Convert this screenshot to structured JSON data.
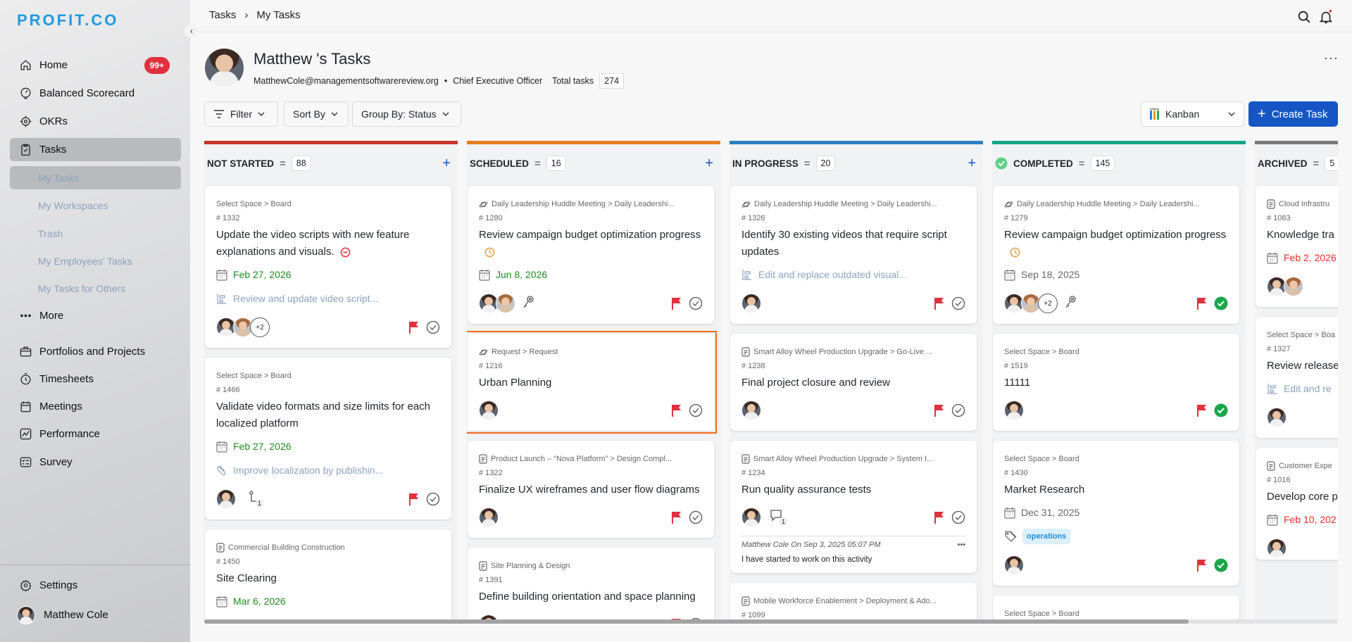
{
  "app": {
    "logo": "PROFIT.CO"
  },
  "sidebar": {
    "home_badge": "99+",
    "items": [
      {
        "label": "Home",
        "icon": "home-icon"
      },
      {
        "label": "Balanced Scorecard",
        "icon": "scorecard-icon"
      },
      {
        "label": "OKRs",
        "icon": "target-icon"
      },
      {
        "label": "Tasks",
        "icon": "clipboard-check-icon"
      },
      {
        "label": "My Tasks"
      },
      {
        "label": "My Workspaces"
      },
      {
        "label": "Trash"
      },
      {
        "label": "My Employees' Tasks"
      },
      {
        "label": "My Tasks for Others"
      },
      {
        "label": "More",
        "icon": "more-icon"
      },
      {
        "label": "Portfolios and Projects",
        "icon": "briefcase-icon"
      },
      {
        "label": "Timesheets",
        "icon": "stopwatch-icon"
      },
      {
        "label": "Meetings",
        "icon": "calendar-icon"
      },
      {
        "label": "Performance",
        "icon": "chart-icon"
      },
      {
        "label": "Survey",
        "icon": "survey-icon"
      }
    ],
    "settings": "Settings",
    "user": "Matthew Cole"
  },
  "breadcrumb": {
    "root": "Tasks",
    "sep": "›",
    "current": "My Tasks"
  },
  "header": {
    "title": "Matthew 's Tasks",
    "email": "MatthewCole@managementsoftwarereview.org",
    "role": "Chief Executive Officer",
    "total_label": "Total tasks",
    "total": "274"
  },
  "toolbar": {
    "filter": "Filter",
    "sort": "Sort By",
    "group": "Group By: Status",
    "view": "Kanban",
    "create": "Create Task"
  },
  "colors": {
    "accent": "#1556c4",
    "not_started": "#c8372d",
    "scheduled": "#e67e22",
    "in_progress": "#2b80be",
    "completed": "#17a589",
    "archived": "#7a7a7a",
    "date_green": "#1e8c1e",
    "date_red": "#ec2a2a"
  },
  "columns": [
    {
      "title": "NOT STARTED",
      "count": "88",
      "color": "#c8372d",
      "plus": true,
      "cards": [
        {
          "crumb": "Select Space > Board",
          "crumb_icon": "",
          "id": "# 1332",
          "title": "Update the video scripts with new feature explanations and visuals.",
          "title_icon": "blocked",
          "date": "Feb 27, 2026",
          "date_color": "green",
          "sub": "Review and update video script...",
          "sub_icon": "subtask",
          "avatars": 2,
          "extra": "+2",
          "status": "open"
        },
        {
          "crumb": "Select Space > Board",
          "crumb_icon": "",
          "id": "# 1466",
          "title": "Validate video formats and size limits for each localized platform",
          "date": "Feb 27, 2026",
          "date_color": "green",
          "sub": "Improve localization by publishin...",
          "sub_icon": "clip",
          "avatars": 1,
          "branch": "1",
          "status": "open"
        },
        {
          "crumb": "Commercial Building Construction",
          "crumb_icon": "doc",
          "id": "# 1450",
          "title": "Site Clearing",
          "date": "Mar 6, 2026",
          "date_color": "green",
          "avatars": 1,
          "status": "open"
        }
      ]
    },
    {
      "title": "SCHEDULED",
      "count": "16",
      "color": "#e67e22",
      "plus": true,
      "cards": [
        {
          "crumb": "Daily Leadership Huddle Meeting > Daily Leadershi...",
          "crumb_icon": "orbit",
          "id": "# 1280",
          "title": "Review campaign budget optimization progress",
          "title_icon": "clock",
          "date": "Jun 8, 2026",
          "date_color": "green",
          "avatars": 2,
          "key": true,
          "status": "open"
        },
        {
          "crumb": "Request > Request",
          "crumb_icon": "orbit",
          "id": "# 1216",
          "title": "Urban Planning",
          "avatars": 1,
          "status": "open",
          "selected": true
        },
        {
          "crumb": "Product Launch – “Nova Platform” > Design Compl...",
          "crumb_icon": "doc",
          "id": "# 1322",
          "title": "Finalize UX wireframes and user flow diagrams",
          "avatars": 1,
          "status": "open"
        },
        {
          "crumb": "Site Planning & Design",
          "crumb_icon": "doc",
          "id": "# 1391",
          "title": "Define building orientation and space planning",
          "avatars": 1,
          "status": "open"
        }
      ]
    },
    {
      "title": "IN PROGRESS",
      "count": "20",
      "color": "#2b80be",
      "plus": true,
      "cards": [
        {
          "crumb": "Daily Leadership Huddle Meeting > Daily Leadershi...",
          "crumb_icon": "orbit",
          "id": "# 1326",
          "title": "Identify 30 existing videos that require script updates",
          "sub": "Edit and replace outdated visual...",
          "sub_icon": "subtask",
          "avatars": 1,
          "status": "open"
        },
        {
          "crumb": "Smart Alloy Wheel Production Upgrade > Go-Live ...",
          "crumb_icon": "doc",
          "id": "# 1238",
          "title": "Final project closure and review",
          "avatars": 1,
          "status": "open"
        },
        {
          "crumb": "Smart Alloy Wheel Production Upgrade > System I...",
          "crumb_icon": "doc",
          "id": "# 1234",
          "title": "Run quality assurance tests",
          "avatars": 1,
          "comments": "1",
          "status": "open",
          "comment": {
            "who": "Matthew Cole On Sep 3, 2025 05:07 PM",
            "text": "I have started to work on this activity"
          }
        },
        {
          "crumb": "Mobile Workforce Enablement > Deployment & Ado...",
          "crumb_icon": "doc",
          "id": "# 1099",
          "title": "Monitor adoption metrics and provide support",
          "avatars": 1,
          "status": "open"
        }
      ]
    },
    {
      "title": "COMPLETED",
      "count": "145",
      "color": "#17a589",
      "done_icon": true,
      "cards": [
        {
          "crumb": "Daily Leadership Huddle Meeting > Daily Leadershi...",
          "crumb_icon": "orbit",
          "id": "# 1279",
          "title": "Review campaign budget optimization progress",
          "title_icon": "clock",
          "date": "Sep 18, 2025",
          "date_color": "grey",
          "avatars": 2,
          "extra": "+2",
          "key": true,
          "status": "done"
        },
        {
          "crumb": "Select Space > Board",
          "crumb_icon": "",
          "id": "# 1519",
          "title": "11111",
          "avatars": 1,
          "status": "done"
        },
        {
          "crumb": "Select Space > Board",
          "crumb_icon": "",
          "id": "# 1430",
          "title": "Market Research",
          "date": "Dec 31, 2025",
          "date_color": "grey",
          "tag": "operations",
          "avatars": 1,
          "status": "done"
        },
        {
          "crumb": "Select Space > Board",
          "crumb_icon": "",
          "id": "",
          "title": "",
          "avatars": 0
        }
      ]
    },
    {
      "title": "ARCHIVED",
      "count": "5",
      "color": "#7a7a7a",
      "cards": [
        {
          "crumb": "Cloud Infrastru",
          "crumb_icon": "doc",
          "id": "# 1083",
          "title": "Knowledge tra",
          "date": "Feb 2, 2026",
          "date_color": "red",
          "avatars": 2
        },
        {
          "crumb": "Select Space > Boa",
          "crumb_icon": "",
          "id": "# 1327",
          "title": "Review release gather details",
          "sub": "Edit and re",
          "sub_icon": "subtask",
          "avatars": 1
        },
        {
          "crumb": "Customer Expe",
          "crumb_icon": "doc",
          "id": "# 1016",
          "title": "Develop core p",
          "date": "Feb 10, 202",
          "date_color": "red",
          "avatars": 1
        }
      ]
    }
  ]
}
